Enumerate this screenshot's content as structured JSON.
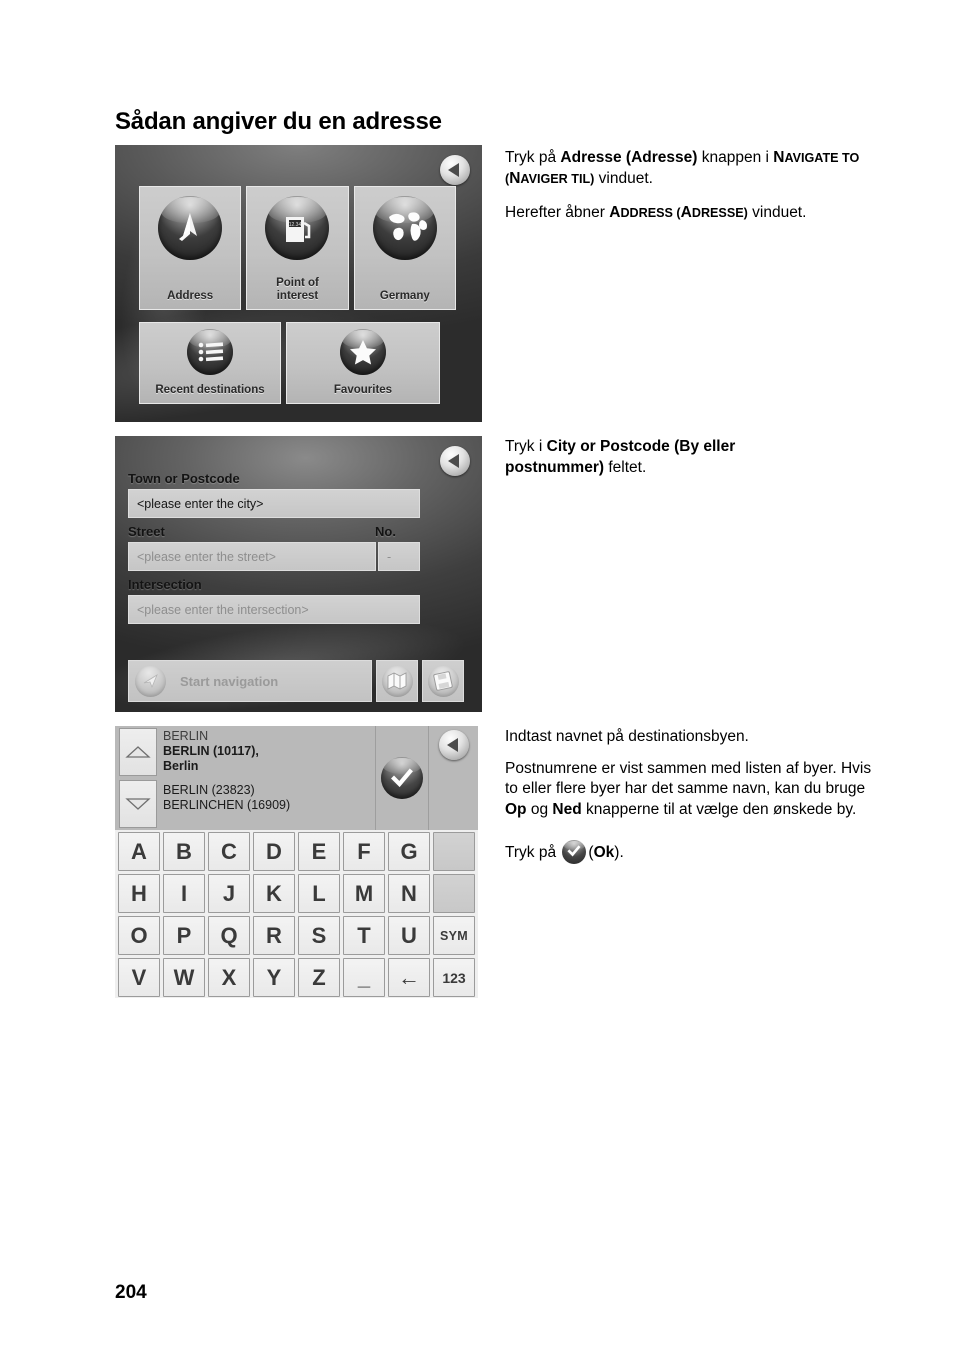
{
  "page": {
    "title": "Sådan angiver du en adresse",
    "number": "204"
  },
  "step1": {
    "screenshot": {
      "name": "navigate-to-window",
      "back_button": "back",
      "tiles": [
        {
          "label": "Address",
          "icon": "compass-flag-icon"
        },
        {
          "label": "Point of\ninterest",
          "icon": "fuel-pump-icon"
        },
        {
          "label": "Germany",
          "icon": "globe-icon"
        },
        {
          "label": "Recent destinations",
          "icon": "list-icon"
        },
        {
          "label": "Favourites",
          "icon": "star-icon"
        }
      ],
      "tile_labels": {
        "address": "Address",
        "poi_line1": "Point of",
        "poi_line2": "interest",
        "country": "Germany",
        "recent": "Recent destinations",
        "favourites": "Favourites"
      }
    },
    "text": {
      "p1_a": "Tryk på ",
      "p1_b": "Adresse (Adresse)",
      "p1_c": "  knappen i ",
      "p1_d_big": "N",
      "p1_d_small": "AVIGATE TO (",
      "p1_e_big": "N",
      "p1_e_small": "AVIGER TIL)",
      "p1_f": " vinduet.",
      "p2_a": "Herefter åbner ",
      "p2_b_big": "A",
      "p2_b_small": "DDRESS (",
      "p2_c_big": "A",
      "p2_c_small": "DRESSE)",
      "p2_d": " vinduet."
    }
  },
  "step2": {
    "screenshot": {
      "name": "address-window",
      "back_button": "back",
      "labels": {
        "town": "Town or Postcode",
        "street": "Street",
        "no": "No.",
        "intersection": "Intersection"
      },
      "fields": {
        "town_value": "<please enter the city>",
        "street_placeholder": "<please enter the street>",
        "no_value": "-",
        "intersection_placeholder": "<please enter the intersection>"
      },
      "toolbar": {
        "start_navigation": "Start navigation",
        "map_button": "map-icon",
        "save_button": "save-destination-icon"
      }
    },
    "text": {
      "p1_a": "Tryk i ",
      "p1_b": "City or Postcode (By eller postnummer)",
      "p1_c": " feltet."
    }
  },
  "step3": {
    "screenshot": {
      "name": "city-entry-window",
      "back_button": "back",
      "list": {
        "header": "BERLIN",
        "selected_line1": "BERLIN (10117),",
        "selected_line2": "Berlin",
        "item2": "BERLIN (23823)",
        "item3": "BERLINCHEN (16909)"
      },
      "up_button": "up-arrow-icon",
      "down_button": "down-arrow-icon",
      "ok_button": "ok-checkmark-icon",
      "keyboard": {
        "row1": [
          "A",
          "B",
          "C",
          "D",
          "E",
          "F",
          "G",
          ""
        ],
        "row2": [
          "H",
          "I",
          "J",
          "K",
          "L",
          "M",
          "N",
          ""
        ],
        "row3": [
          "O",
          "P",
          "Q",
          "R",
          "S",
          "T",
          "U",
          "SYM"
        ],
        "row4": [
          "V",
          "W",
          "X",
          "Y",
          "Z",
          "_",
          "←",
          "123"
        ]
      }
    },
    "text": {
      "p1": "Indtast navnet på destinationsbyen.",
      "p2_a": "Postnumrene er vist sammen med listen af byer. Hvis to eller flere byer har det samme navn, kan du bruge ",
      "p2_b": "Op",
      "p2_c": " og ",
      "p2_d": "Ned",
      "p2_e": " knapperne til at vælge den ønskede by.",
      "p3_a": "Tryk på ",
      "p3_b": "(",
      "p3_c": "Ok",
      "p3_d": ")."
    }
  },
  "colors": {
    "page_background": "#ffffff",
    "text": "#000000",
    "screen_dark": "#3a3a3a",
    "key_face": "#f0f0f0",
    "list_background": "#b9b9b9"
  }
}
